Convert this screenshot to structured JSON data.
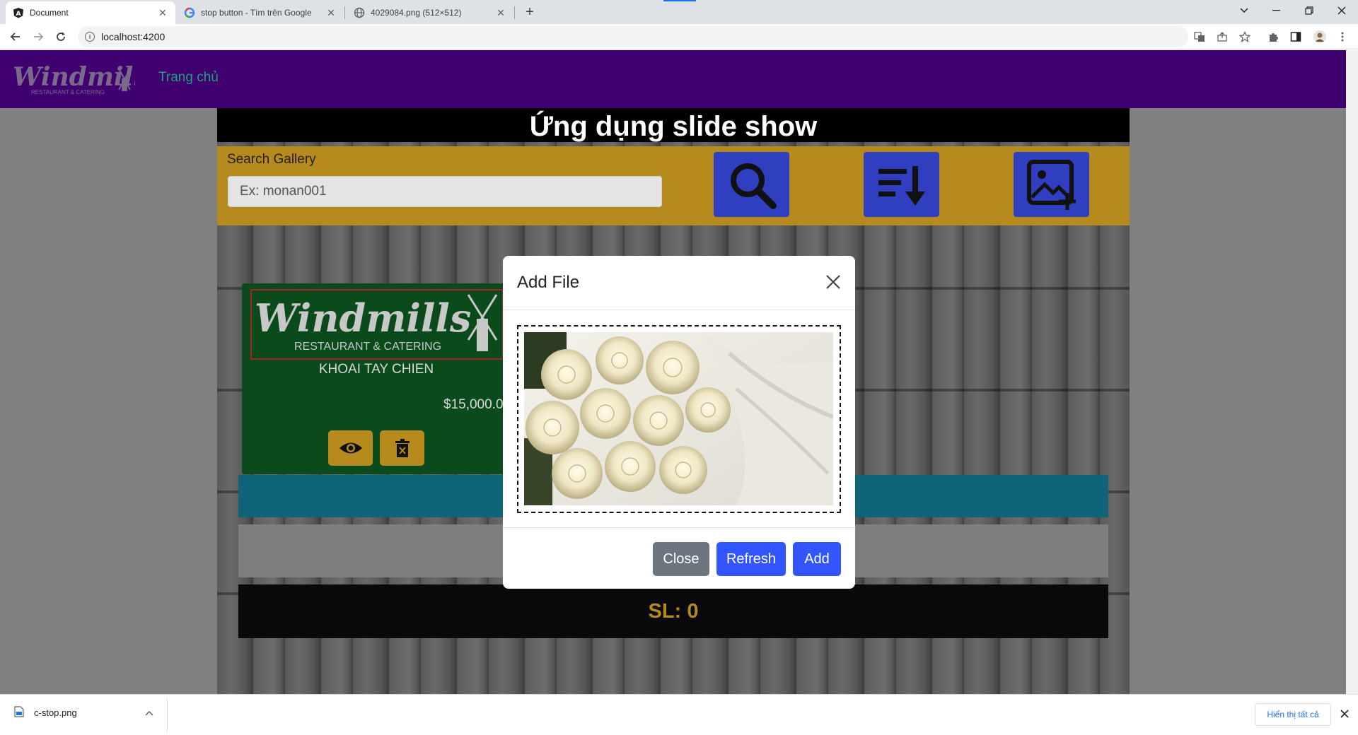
{
  "browser": {
    "tabs": [
      {
        "title": "Document",
        "active": true
      },
      {
        "title": "stop button - Tìm trên Google",
        "active": false
      },
      {
        "title": "4029084.png (512×512)",
        "active": false
      }
    ],
    "url": "localhost:4200"
  },
  "app": {
    "nav_link": "Trang chủ",
    "header_title": "Ứng dụng slide show",
    "search": {
      "label": "Search Gallery",
      "placeholder": "Ex: monan001"
    },
    "card": {
      "logo_text": "Windmills",
      "logo_subtext": "RESTAURANT & CATERING",
      "name": "KHOAI TAY CHIEN",
      "price": "$15,000.00"
    },
    "count_text": "SL: 0"
  },
  "modal": {
    "title": "Add File",
    "close_label": "Close",
    "refresh_label": "Refresh",
    "add_label": "Add"
  },
  "downloads": {
    "file_name": "c-stop.png",
    "show_all_label": "Hiển thị tất cả"
  },
  "colors": {
    "nav_bg": "#400070",
    "search_panel": "#b68a1d",
    "primary_button": "#3355ff",
    "secondary_button": "#6c757d",
    "card_bg": "#0b4a1b"
  }
}
